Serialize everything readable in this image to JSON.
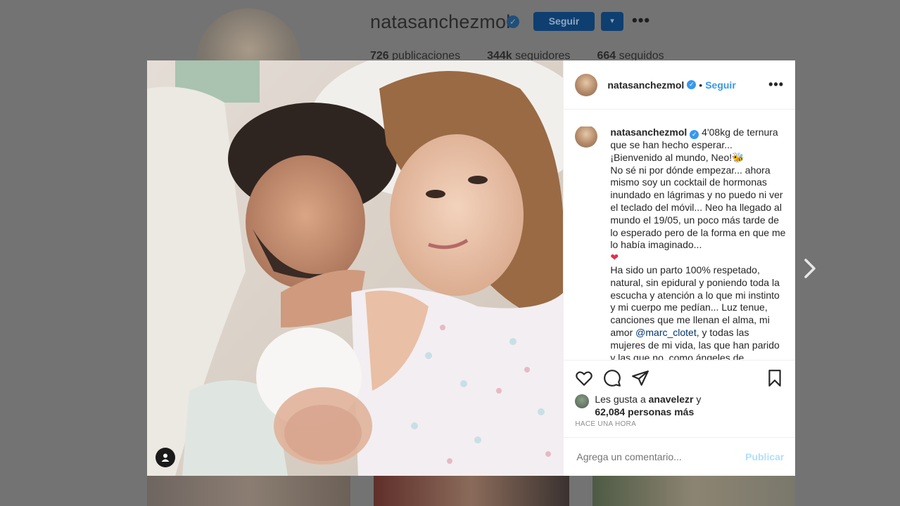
{
  "profile": {
    "username": "natasanchezmol",
    "follow_label": "Seguir",
    "dropdown_label": "▾",
    "more_label": "•••",
    "stats": [
      {
        "count": "726",
        "label": "publicaciones"
      },
      {
        "count": "344k",
        "label": "seguidores"
      },
      {
        "count": "664",
        "label": "seguidos"
      }
    ]
  },
  "post": {
    "username": "natasanchezmol",
    "separator": "•",
    "follow_label": "Seguir",
    "more_label": "•••",
    "caption": {
      "p1": " 4'08kg de ternura que se han hecho esperar...\n¡Bienvenido al mundo, Neo!",
      "p1_emoji": "🐝",
      "p2": "\nNo sé ni por dónde empezar... ahora mismo soy un cocktail de hormonas inundado en lágrimas y no puedo ni ver el teclado del móvil... Neo ha llegado al mundo el 19/05, un poco más tarde de lo esperado pero de la forma en que me lo había imaginado...\n",
      "heart": "❤",
      "p3": "\nHa sido un parto 100% respetado, natural, sin epidural y poniendo toda la escucha y atención a lo que mi instinto y mi cuerpo me pedían... Luz tenue, canciones que me llenan el alma, mi amor ",
      "mention": "@marc_clotet",
      "p4": ", y todas las mujeres de mi vida, las que han parido y las que no, como ángeles de"
    },
    "likes": {
      "prefix": "Les gusta a ",
      "user": "anavelezr",
      "middle": " y",
      "count": "62,084 personas más"
    },
    "time": "HACE UNA HORA",
    "comment_placeholder": "Agrega un comentario...",
    "publish_label": "Publicar"
  },
  "icons": {
    "like": "heart-outline-icon",
    "comment": "comment-bubble-icon",
    "share": "paper-plane-icon",
    "save": "bookmark-icon",
    "tag": "user-tag-icon",
    "next": "chevron-right-icon"
  },
  "colors": {
    "accent": "#3897f0",
    "publish_disabled": "#b2dffc",
    "mention": "#003569",
    "heart": "#e1304c"
  }
}
